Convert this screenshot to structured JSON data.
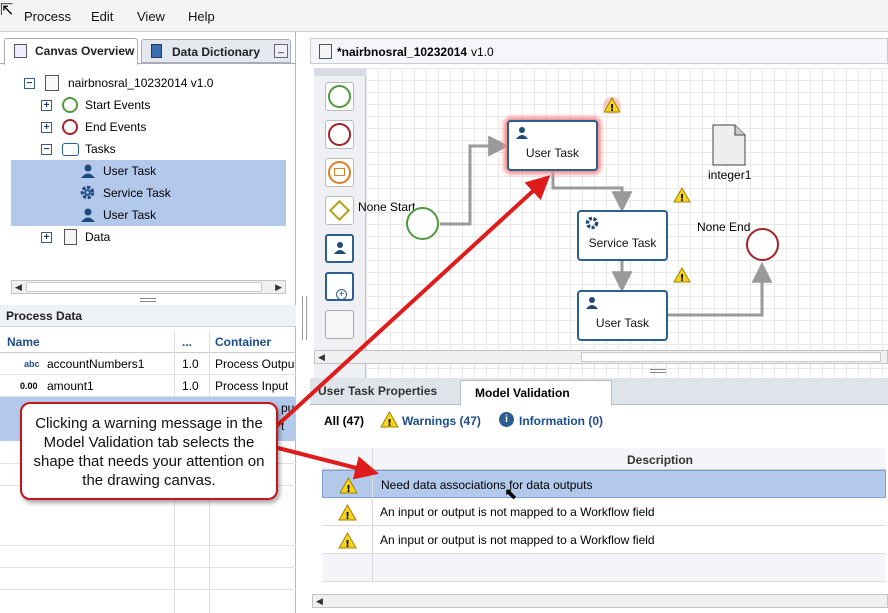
{
  "menu": {
    "items": [
      "Process",
      "Edit",
      "View",
      "Help"
    ]
  },
  "left_tabs": {
    "canvas_overview": "Canvas Overview",
    "data_dictionary": "Data Dictionary"
  },
  "tree": {
    "root": "nairbnosral_10232014  v1.0",
    "start_events": "Start Events",
    "end_events": "End Events",
    "tasks": "Tasks",
    "children": [
      "User Task",
      "Service Task",
      "User Task"
    ],
    "data": "Data"
  },
  "process_data": {
    "title": "Process Data",
    "columns": [
      "Name",
      "...",
      "Container"
    ],
    "rows": [
      {
        "type": "abc",
        "name": "accountNumbers1",
        "ver": "1.0",
        "container": "Process Outpu"
      },
      {
        "type": "0.00",
        "name": "amount1",
        "ver": "1.0",
        "container": "Process Input"
      }
    ],
    "partial_container": [
      "pu",
      "t"
    ]
  },
  "editor": {
    "tab_title": "*nairbnosral_10232014",
    "version": "v1.0"
  },
  "canvas": {
    "start_label": "None Start",
    "user_task_1": "User Task",
    "service_task": "Service Task",
    "user_task_2": "User Task",
    "end_label": "None End",
    "data_object": "integer1"
  },
  "bottom_tabs": {
    "props": "User Task Properties",
    "validation": "Model Validation"
  },
  "filters": {
    "all": "All (47)",
    "warnings": "Warnings (47)",
    "information": "Information (0)"
  },
  "validation": {
    "header": "Description",
    "rows": [
      "Need data associations for data outputs",
      "An input or output is not mapped to a Workflow field",
      "An input or output is not mapped to a Workflow field"
    ]
  },
  "callout": {
    "text": "Clicking a warning message in the Model Validation tab selects the shape that needs your attention on the drawing canvas."
  },
  "colors": {
    "accent": "#2b5f91",
    "selection": "#b3c9ec",
    "start": "#4f9a3c",
    "end": "#a3222a",
    "warning": "#f6d31f",
    "arrow": "#e01b1b"
  }
}
